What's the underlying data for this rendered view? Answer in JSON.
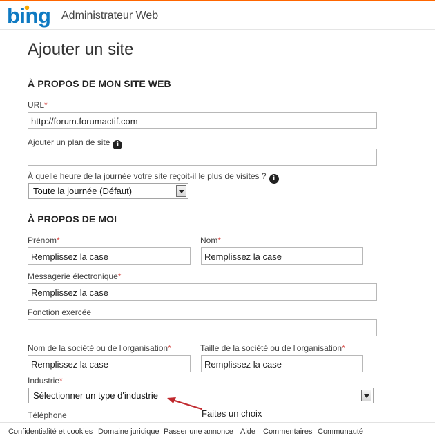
{
  "header": {
    "logo_text": "bing",
    "app_title": "Administrateur Web"
  },
  "page": {
    "title": "Ajouter un site"
  },
  "site_section": {
    "heading": "À PROPOS DE MON SITE WEB",
    "url_label": "URL",
    "url_value": "http://forum.forumactif.com",
    "sitemap_label": "Ajouter un plan de site",
    "sitemap_value": "",
    "peak_label": "À quelle heure de la journée votre site reçoit-il le plus de visites ?",
    "peak_selected": "Toute la journée (Défaut)"
  },
  "me_section": {
    "heading": "À PROPOS DE MOI",
    "firstname_label": "Prénom",
    "firstname_value": "Remplissez la case",
    "lastname_label": "Nom",
    "lastname_value": "Remplissez la case",
    "email_label": "Messagerie électronique",
    "email_value": "Remplissez la case",
    "job_label": "Fonction exercée",
    "job_value": "",
    "company_label": "Nom de la société ou de l'organisation",
    "company_value": "Remplissez la case",
    "size_label": "Taille de la société ou de l'organisation",
    "size_value": "Remplissez la case",
    "industry_label": "Industrie",
    "industry_selected": "Sélectionner un type d'industrie",
    "phone_label": "Téléphone"
  },
  "required_mark": "*",
  "annotation": {
    "text": "Faites un choix",
    "color": "#c0282d"
  },
  "footer": {
    "links": [
      "Confidentialité et cookies",
      "Domaine juridique",
      "Passer une annonce",
      "Aide",
      "Commentaires",
      "Communauté"
    ]
  },
  "colors": {
    "accent_top": "#ff6600",
    "bing_blue": "#0f7ac2",
    "required": "#d9534f"
  }
}
